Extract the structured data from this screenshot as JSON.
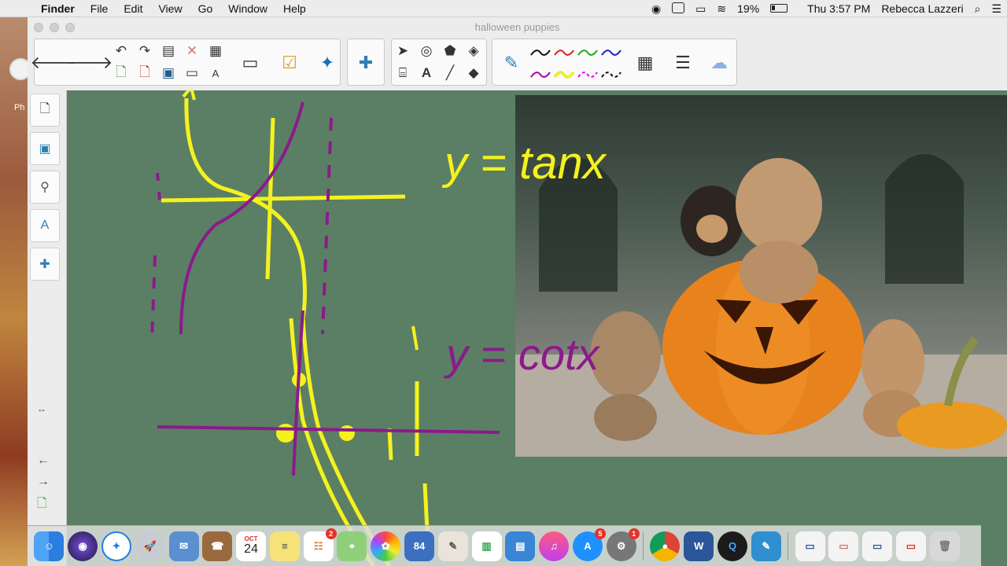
{
  "menubar": {
    "app": "Finder",
    "items": [
      "File",
      "Edit",
      "View",
      "Go",
      "Window",
      "Help"
    ],
    "battery": "19%",
    "clock": "Thu 3:57 PM",
    "user": "Rebecca Lazzeri"
  },
  "desktop": {
    "label": "Ph"
  },
  "window": {
    "title": "halloween puppies"
  },
  "canvas": {
    "equation1": "y = tanx",
    "equation2": "y = cotx"
  },
  "dock": {
    "calendar_month": "OCT",
    "calendar_day": "24",
    "reminders_badge": "2",
    "appstore_badge": "5",
    "prefs_badge": "1",
    "chart_label": "84"
  },
  "colors": {
    "accent": "#2f7fb0",
    "board": "#5b7f64",
    "yellow": "#f4f21e",
    "purple": "#8b1a8b"
  }
}
